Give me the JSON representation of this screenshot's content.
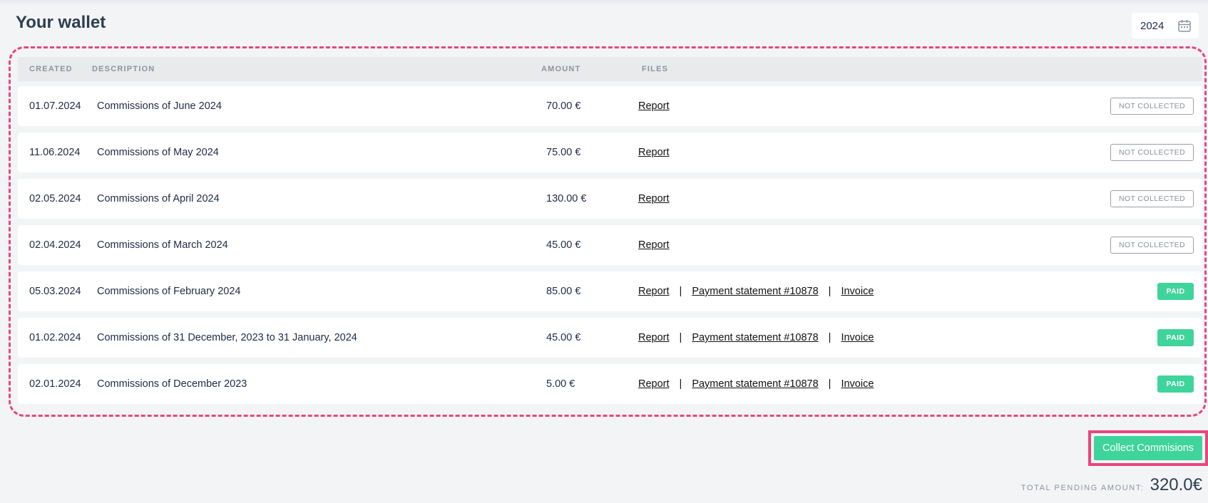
{
  "page": {
    "title": "Your wallet",
    "year": "2024"
  },
  "table": {
    "headers": {
      "created": "CREATED",
      "description": "DESCRIPTION",
      "amount": "AMOUNT",
      "files": "FILES"
    },
    "rows": [
      {
        "created": "01.07.2024",
        "description": "Commissions of June 2024",
        "amount": "70.00 €",
        "files": [
          "Report"
        ],
        "status": "NOT COLLECTED"
      },
      {
        "created": "11.06.2024",
        "description": "Commissions of May 2024",
        "amount": "75.00 €",
        "files": [
          "Report"
        ],
        "status": "NOT COLLECTED"
      },
      {
        "created": "02.05.2024",
        "description": "Commissions of April 2024",
        "amount": "130.00 €",
        "files": [
          "Report"
        ],
        "status": "NOT COLLECTED"
      },
      {
        "created": "02.04.2024",
        "description": "Commissions of March 2024",
        "amount": "45.00 €",
        "files": [
          "Report"
        ],
        "status": "NOT COLLECTED"
      },
      {
        "created": "05.03.2024",
        "description": "Commissions of February 2024",
        "amount": "85.00 €",
        "files": [
          "Report",
          "Payment statement #10878",
          "Invoice"
        ],
        "status": "PAID"
      },
      {
        "created": "01.02.2024",
        "description": "Commissions of 31 December, 2023 to 31 January, 2024",
        "amount": "45.00 €",
        "files": [
          "Report",
          "Payment statement #10878",
          "Invoice"
        ],
        "status": "PAID"
      },
      {
        "created": "02.01.2024",
        "description": "Commissions of December 2023",
        "amount": "5.00 €",
        "files": [
          "Report",
          "Payment statement #10878",
          "Invoice"
        ],
        "status": "PAID"
      }
    ]
  },
  "actions": {
    "collect_label": "Collect Commisions"
  },
  "summary": {
    "pending_label": "TOTAL PENDING AMOUNT:",
    "pending_value": "320.0€"
  },
  "colors": {
    "accent": "#3fd49b",
    "highlight": "#e8467c",
    "background": "#f3f4f6"
  },
  "icons": {
    "year_picker": "calendar-icon"
  }
}
